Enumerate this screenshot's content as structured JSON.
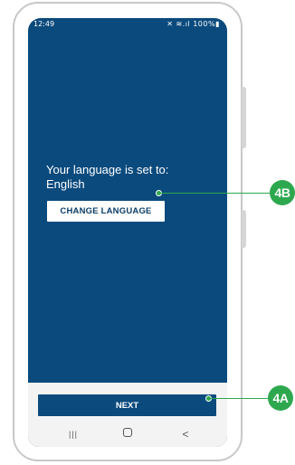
{
  "status_bar": {
    "time": "12:49",
    "icons_text": "✕ ≋.ıl 100%▮",
    "icon_names": [
      "mute-icon",
      "wifi-icon",
      "signal-icon",
      "battery-icon"
    ],
    "battery": "100%"
  },
  "screen": {
    "heading_line1": "Your language is set to:",
    "heading_line2": "English",
    "change_language_label": "CHANGE LANGUAGE",
    "next_label": "NEXT",
    "background_color": "#0b4a7d"
  },
  "nav_bar": {
    "recent_glyph": "|||",
    "home_glyph": "",
    "back_glyph": "<",
    "icon_names": [
      "recent-apps-icon",
      "home-icon",
      "back-icon"
    ]
  },
  "callouts": {
    "change_language": "4B",
    "next": "4A",
    "color": "#2ea84f"
  }
}
